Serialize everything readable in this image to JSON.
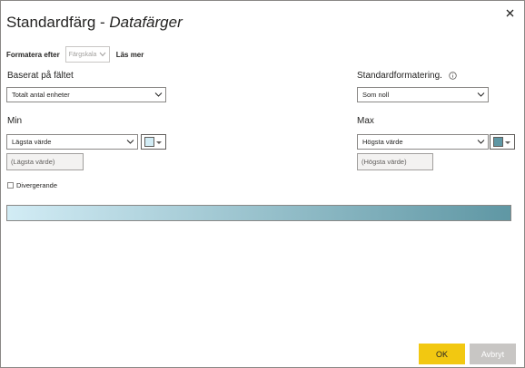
{
  "colors": {
    "accent": "#f2c811",
    "gradient_start": "#d2ecf5",
    "gradient_end": "#5f97a4",
    "min_swatch": "#d2ecf5",
    "max_swatch": "#5f97a4",
    "cancel_bg": "#c8c6c4",
    "cancel_text": "#ffffff",
    "ok_text": "#252423"
  },
  "dialog": {
    "title": "Standardfärg",
    "title_separator": " - ",
    "subtitle": "Datafärger",
    "close_icon": "close-icon"
  },
  "format_by": {
    "label": "Formatera efter",
    "value": "Färgskala",
    "learn_more": "Läs mer"
  },
  "based_on": {
    "label": "Baserat på fältet",
    "value": "Totalt antal enheter"
  },
  "default_formatting": {
    "label": "Standardformatering.",
    "info_icon": "info-icon",
    "value": "Som noll"
  },
  "min": {
    "label": "Min",
    "dropdown_value": "Lägsta värde",
    "input_value": "(Lägsta värde)"
  },
  "max": {
    "label": "Max",
    "dropdown_value": "Högsta värde",
    "input_value": "(Högsta värde)"
  },
  "diverging": {
    "label": "Divergerande",
    "checked": false
  },
  "buttons": {
    "ok": "OK",
    "cancel": "Avbryt"
  }
}
